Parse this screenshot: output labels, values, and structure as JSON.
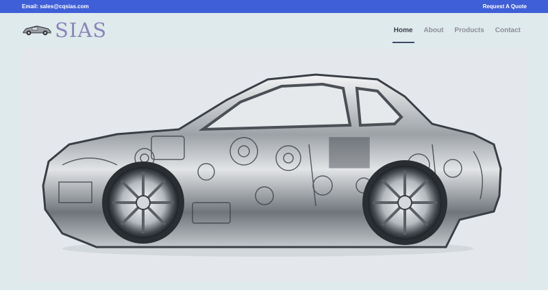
{
  "topbar": {
    "email": "Email: sales@cqsias.com",
    "quote": "Request A Quote"
  },
  "brand": {
    "name": "SIAS"
  },
  "nav": {
    "items": [
      "Home",
      "About",
      "Products",
      "Contact"
    ],
    "active": "Home"
  },
  "colors": {
    "topbar": "#3f5fd8",
    "header_bg": "#dfeaec",
    "logo_text": "#8b86b8",
    "nav_active": "#3a3f4a",
    "nav_inactive": "#8d8f97"
  },
  "hero": {
    "image": "chrome-car-parts-collage"
  }
}
